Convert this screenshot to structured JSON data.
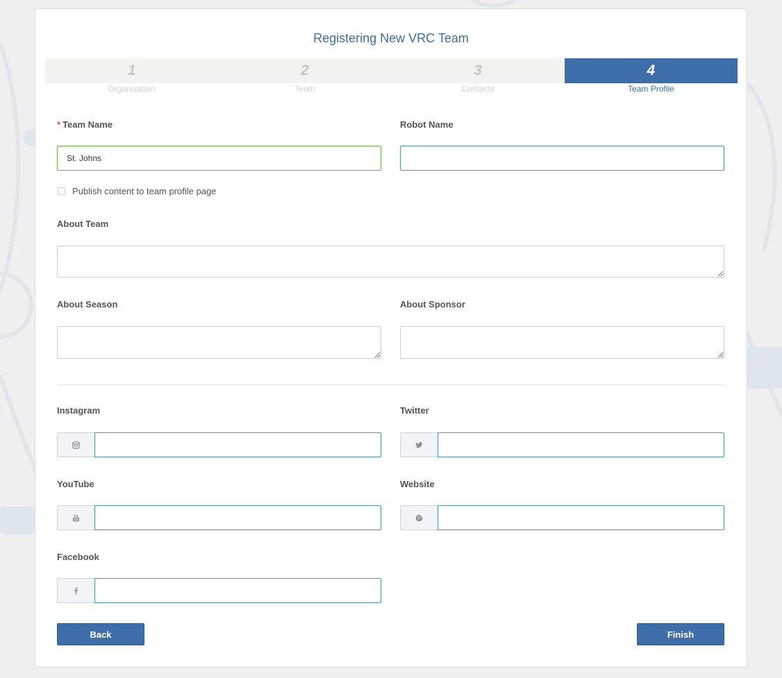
{
  "page_title": "Registering New VRC Team",
  "steps": [
    {
      "num": "1",
      "label": "Organization"
    },
    {
      "num": "2",
      "label": "Team"
    },
    {
      "num": "3",
      "label": "Contacts"
    },
    {
      "num": "4",
      "label": "Team Profile"
    }
  ],
  "form": {
    "team_name": {
      "required_mark": "*",
      "label": "Team Name",
      "value": "St. Johns"
    },
    "robot_name": {
      "label": "Robot Name",
      "value": ""
    },
    "publish": {
      "label": "Publish content to team profile page",
      "checked": false
    },
    "about_team": {
      "label": "About Team"
    },
    "about_season": {
      "label": "About Season"
    },
    "about_sponsor": {
      "label": "About Sponsor"
    },
    "instagram": {
      "label": "Instagram",
      "icon": "instagram-icon"
    },
    "twitter": {
      "label": "Twitter",
      "icon": "twitter-icon"
    },
    "youtube": {
      "label": "YouTube",
      "icon": "youtube-icon"
    },
    "website": {
      "label": "Website",
      "icon": "globe-icon"
    },
    "facebook": {
      "label": "Facebook",
      "icon": "facebook-icon"
    }
  },
  "buttons": {
    "back": "Back",
    "finish": "Finish"
  },
  "colors": {
    "accent": "#3d6eaa",
    "valid_border": "#6bb640",
    "focus_border": "#4a90d9",
    "required": "#d9534f"
  }
}
